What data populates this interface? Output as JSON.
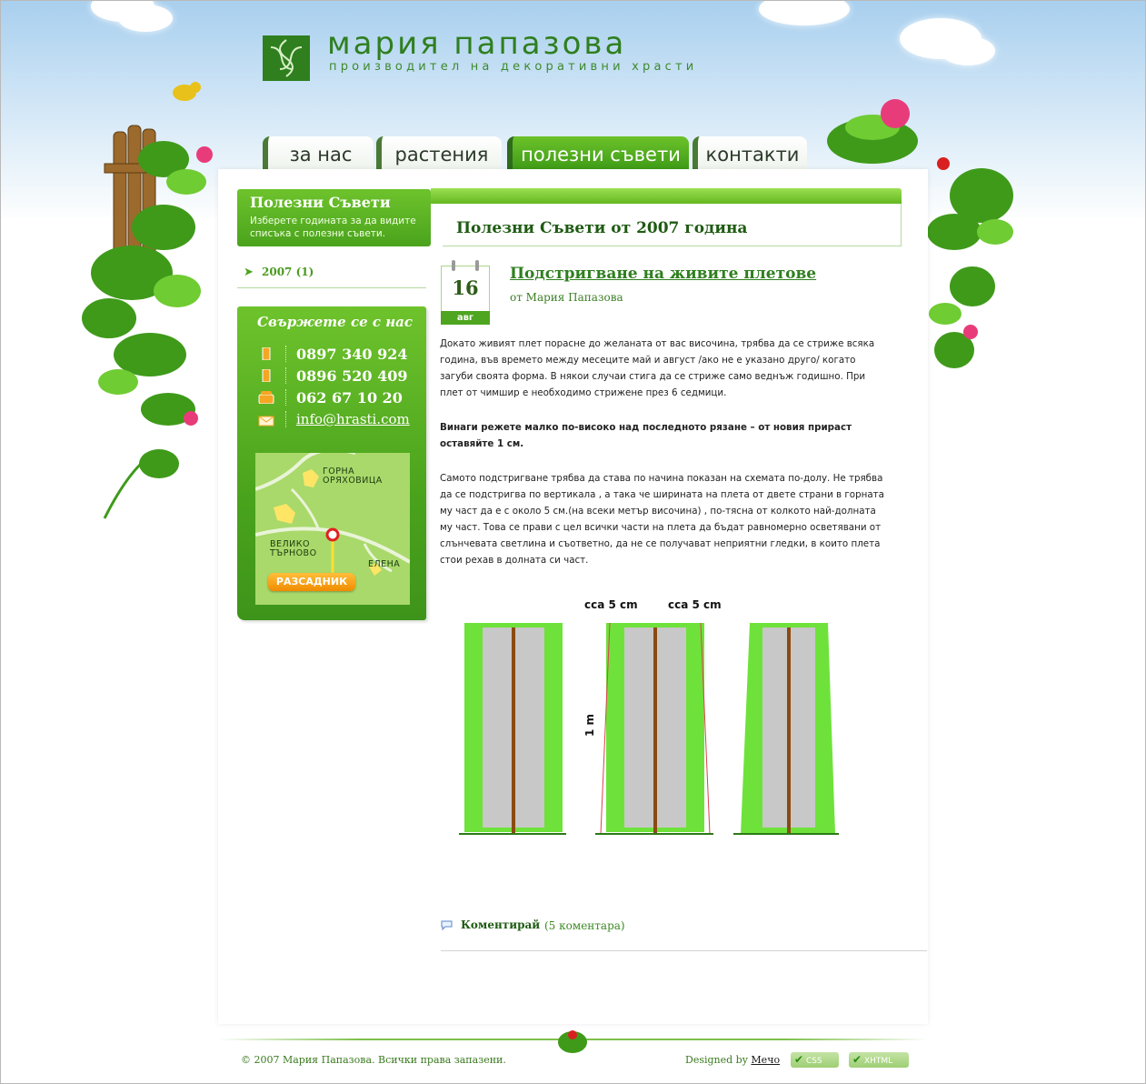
{
  "header": {
    "brand": "мария папазова",
    "tagline": "производител на декоративни храсти"
  },
  "nav": {
    "tabs": [
      {
        "label": "за нас",
        "active": false
      },
      {
        "label": "растения",
        "active": false
      },
      {
        "label": "полезни съвети",
        "active": true
      },
      {
        "label": "контакти",
        "active": false
      }
    ]
  },
  "sidebar": {
    "title": "Полезни Съвети",
    "subtitle": "Изберете годината за да видите списъка с полезни съвети.",
    "years": [
      {
        "label": "2007 (1)"
      }
    ]
  },
  "contact": {
    "title": "Свържете се с нас",
    "phone1": "0897 340 924",
    "phone2": "0896 520 409",
    "landline": "062 67 10 20",
    "email": "info@hrasti.com"
  },
  "map": {
    "town1": "ГОРНА\nОРЯХОВИЦА",
    "town2": "ВЕЛИКО\nТЪРНОВО",
    "town3": "ЕЛЕНА",
    "button": "РАЗСАДНИК"
  },
  "main": {
    "section_title": "Полезни Съвети от 2007 година",
    "post": {
      "day": "16",
      "month": "авг",
      "title": "Подстригване на живите плетове",
      "author": "от Мария Папазова",
      "paragraph1": "Докато живият плет порасне до желаната от вас височина, трябва да се стриже всяка година, във времето между месеците май и август /ако не е указано друго/ когато загуби своята форма. В някои случаи стига да се стриже само веднъж годишно. При плет от чимшир е необходимо стрижене през 6 седмици.",
      "paragraph2": "Винаги режете малко по-високо над последното рязане – от новия прираст оставяйте 1 см.",
      "paragraph3": "Самото подстригване трябва да става по начина показан на схемата по-долу. Не трябва да се подстригва по вертикала , а така че ширината на плета от двете страни в горната му част да е с около 5 см.(на всеки метър височина) , по-тясна от колкото най-долната му част. Това се прави с цел всички части на плета да бъдат равномерно осветявани от слънчевата светлина и съответно, да не се получават неприятни гледки, в които плета стои рехав в долната си част.",
      "diagram_label_left": "cca 5 cm",
      "diagram_label_right": "cca 5 cm",
      "diagram_label_height": "1 m",
      "comment_label": "Коментирай",
      "comment_count": "(5 коментара)"
    }
  },
  "footer": {
    "copyright": "© 2007 Мария Папазова. Всички права запазени.",
    "designed_by": "Designed by",
    "designer": "Мечо",
    "badge_css": "CSS",
    "badge_xhtml": "XHTML"
  },
  "colors": {
    "brand_green": "#2f7f1f",
    "accent_green": "#4aa31c",
    "sky": "#a8cfee"
  }
}
